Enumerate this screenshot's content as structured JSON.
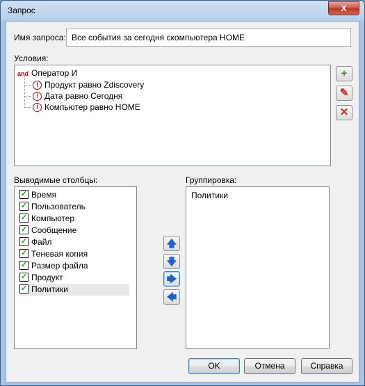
{
  "dialog": {
    "title": "Запрос",
    "close_symbol": "X"
  },
  "query_name": {
    "label": "Имя запроса:",
    "value": "Все события за сегодня скомпьютера HOME"
  },
  "conditions": {
    "label": "Условия:",
    "root": {
      "badge": "and",
      "label": "Оператор И"
    },
    "items": [
      {
        "icon": "warning-icon",
        "label": "Продукт равно Zdiscovery"
      },
      {
        "icon": "warning-icon",
        "label": "Дата равно Сегодня"
      },
      {
        "icon": "warning-icon",
        "label": "Компьютер равно HOME"
      }
    ],
    "buttons": [
      {
        "icon": "add-icon",
        "glyph": "+",
        "color": "#2a9d2a"
      },
      {
        "icon": "edit-icon",
        "glyph": "✎",
        "color": "#c8301e"
      },
      {
        "icon": "delete-icon",
        "glyph": "✕",
        "color": "#d0241a"
      }
    ]
  },
  "output_columns": {
    "label": "Выводимые столбцы:",
    "items": [
      {
        "label": "Время",
        "checked": true
      },
      {
        "label": "Пользователь",
        "checked": true
      },
      {
        "label": "Компьютер",
        "checked": true
      },
      {
        "label": "Сообщение",
        "checked": true
      },
      {
        "label": "Файл",
        "checked": true
      },
      {
        "label": "Теневая копия",
        "checked": true
      },
      {
        "label": "Размер файла",
        "checked": true
      },
      {
        "label": "Продукт",
        "checked": true
      },
      {
        "label": "Политики",
        "checked": true,
        "selected": true
      }
    ]
  },
  "move_buttons": [
    {
      "icon": "arrow-up-icon",
      "glyph": "🡅"
    },
    {
      "icon": "arrow-down-icon",
      "glyph": "🡇"
    },
    {
      "icon": "arrow-right-icon",
      "glyph": "🡆"
    },
    {
      "icon": "arrow-left-icon",
      "glyph": "🡄"
    }
  ],
  "grouping": {
    "label": "Группировка:",
    "items": [
      "Политики"
    ]
  },
  "footer": {
    "ok": "OK",
    "cancel": "Отмена",
    "help": "Справка"
  }
}
